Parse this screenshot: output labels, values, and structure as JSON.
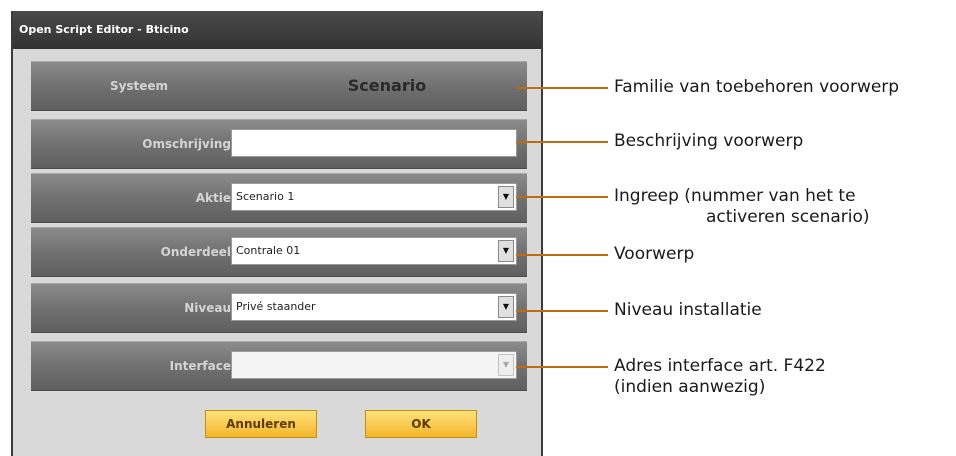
{
  "window": {
    "title": "Open Script Editor - Bticino"
  },
  "rows": {
    "systeem": {
      "label": "Systeem",
      "value": "Scenario"
    },
    "omschrijving": {
      "label": "Omschrijving",
      "value": ""
    },
    "aktie": {
      "label": "Aktie",
      "value": "Scenario 1"
    },
    "onderdeel": {
      "label": "Onderdeel",
      "value": "Contrale 01"
    },
    "niveau": {
      "label": "Niveau",
      "value": "Privé staander"
    },
    "interface": {
      "label": "Interface",
      "value": ""
    }
  },
  "buttons": {
    "cancel": "Annuleren",
    "ok": "OK"
  },
  "callouts": {
    "familie": "Familie van toebehoren voorwerp",
    "beschrijving": "Beschrijving voorwerp",
    "ingreep_1": "Ingreep (nummer van het te",
    "ingreep_2": "activeren scenario)",
    "voorwerp": "Voorwerp",
    "niveau": "Niveau installatie",
    "adres_1": "Adres interface art. F422",
    "adres_2": "(indien aanwezig)"
  },
  "colors": {
    "callout_line": "#c06a12",
    "button": "#f3b62a",
    "row": "#6f6f6f"
  },
  "icons": {
    "dropdown": "chevron-down-icon"
  }
}
